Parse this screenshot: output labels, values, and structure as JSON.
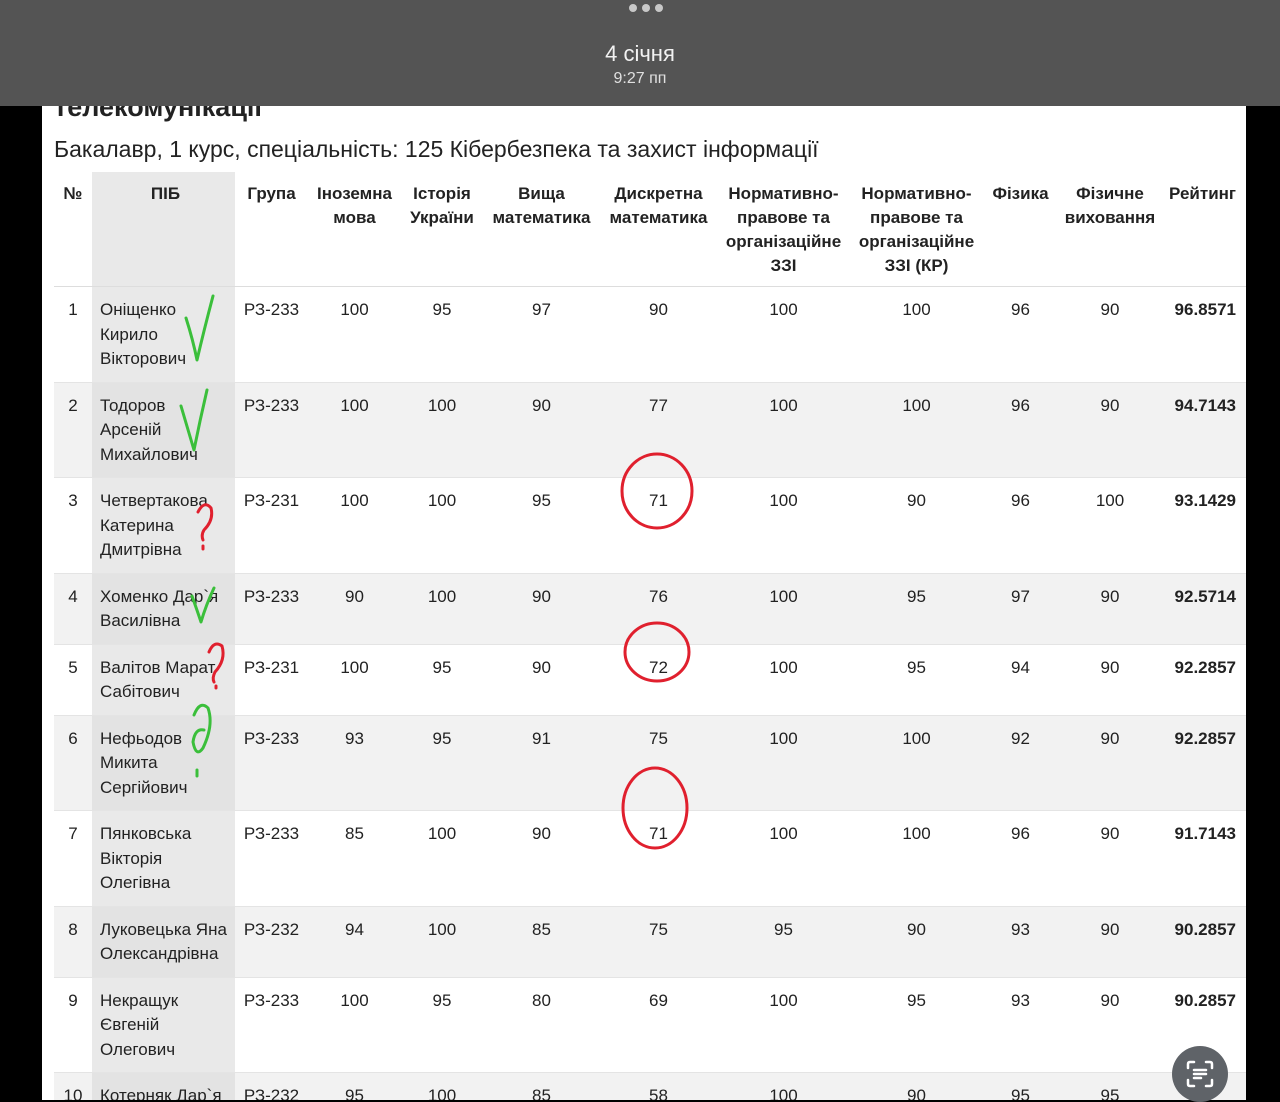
{
  "status_bar": {
    "date": "4 січня",
    "time": "9:27 пп"
  },
  "page": {
    "title_cut": "телекомунікації",
    "subtitle": "Бакалавр, 1 курс, спеціальність: 125 Кібербезпека та захист інформації"
  },
  "table": {
    "headers": [
      "№",
      "ПІБ",
      "Група",
      "Іноземна мова",
      "Історія України",
      "Вища математика",
      "Дискретна математика",
      "Нормативно-правове та організаційне ЗЗІ",
      "Нормативно-правове та організаційне ЗЗІ (КР)",
      "Фізика",
      "Фізичне виховання",
      "Рейтинг"
    ],
    "rows": [
      [
        "1",
        "Оніщенко Кирило Вікторович",
        "РЗ-233",
        "100",
        "95",
        "97",
        "90",
        "100",
        "100",
        "96",
        "90",
        "96.8571"
      ],
      [
        "2",
        "Тодоров Арсеній Михайлович",
        "РЗ-233",
        "100",
        "100",
        "90",
        "77",
        "100",
        "100",
        "96",
        "90",
        "94.7143"
      ],
      [
        "3",
        "Четвертакова Катерина Дмитрівна",
        "РЗ-231",
        "100",
        "100",
        "95",
        "71",
        "100",
        "90",
        "96",
        "100",
        "93.1429"
      ],
      [
        "4",
        "Хоменко Дар`я Василівна",
        "РЗ-233",
        "90",
        "100",
        "90",
        "76",
        "100",
        "95",
        "97",
        "90",
        "92.5714"
      ],
      [
        "5",
        "Валітов Марат Сабітович",
        "РЗ-231",
        "100",
        "95",
        "90",
        "72",
        "100",
        "95",
        "94",
        "90",
        "92.2857"
      ],
      [
        "6",
        "Нефьодов Микита Сергійович",
        "РЗ-233",
        "93",
        "95",
        "91",
        "75",
        "100",
        "100",
        "92",
        "90",
        "92.2857"
      ],
      [
        "7",
        "Пянковська Вікторія Олегівна",
        "РЗ-233",
        "85",
        "100",
        "90",
        "71",
        "100",
        "100",
        "96",
        "90",
        "91.7143"
      ],
      [
        "8",
        "Луковецька Яна Олександрівна",
        "РЗ-232",
        "94",
        "100",
        "85",
        "75",
        "95",
        "90",
        "93",
        "90",
        "90.2857"
      ],
      [
        "9",
        "Некращук Євгеній Олегович",
        "РЗ-233",
        "100",
        "95",
        "80",
        "69",
        "100",
        "95",
        "93",
        "90",
        "90.2857"
      ],
      [
        "10",
        "Котерняк Дар`я Олексіївна",
        "РЗ-232",
        "95",
        "100",
        "85",
        "58",
        "100",
        "90",
        "95",
        "95",
        ""
      ]
    ]
  },
  "annotation_colors": {
    "check": "#3bbf3b",
    "question": "#e0202e",
    "circle": "#e0202e"
  }
}
